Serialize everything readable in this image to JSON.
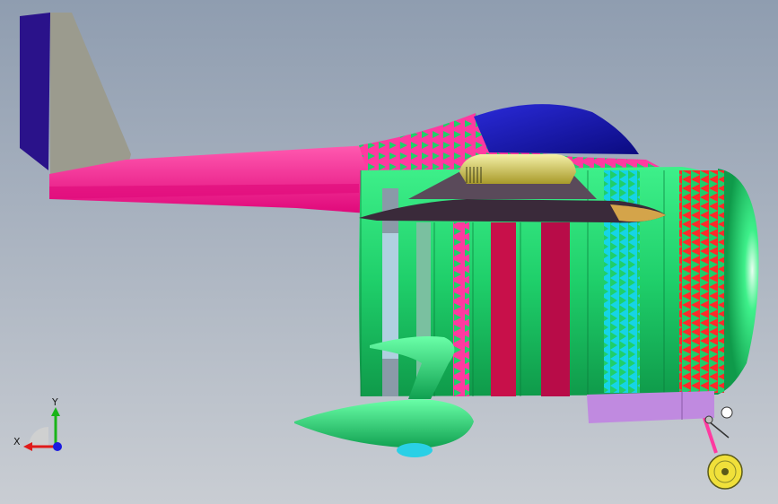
{
  "viewport": {
    "background_top": "#8f9db0",
    "background_bottom": "#c7ccd2"
  },
  "model": {
    "name": "aircraft-assembly",
    "colors": {
      "fuselage_green": "#1fcf6a",
      "tail_pink": "#ff1f8a",
      "fin_grey": "#9b9b8e",
      "fin_navy": "#2a128a",
      "canopy_blue": "#1a1ac8",
      "wing_dark": "#3a2a3a",
      "wing_gold": "#d4c04a",
      "strut_green": "#2be07a",
      "pod_lilac": "#c08ae0",
      "stripe_red": "#ff2a2a",
      "stripe_cyan": "#16d4e6",
      "stripe_crimson": "#c8104a",
      "wheel_yellow": "#f0e03a"
    }
  },
  "triad": {
    "y_label": "Y",
    "x_label": "X",
    "colors": {
      "y": "#19b419",
      "x": "#e01a1a",
      "z": "#1a1ae0"
    }
  }
}
